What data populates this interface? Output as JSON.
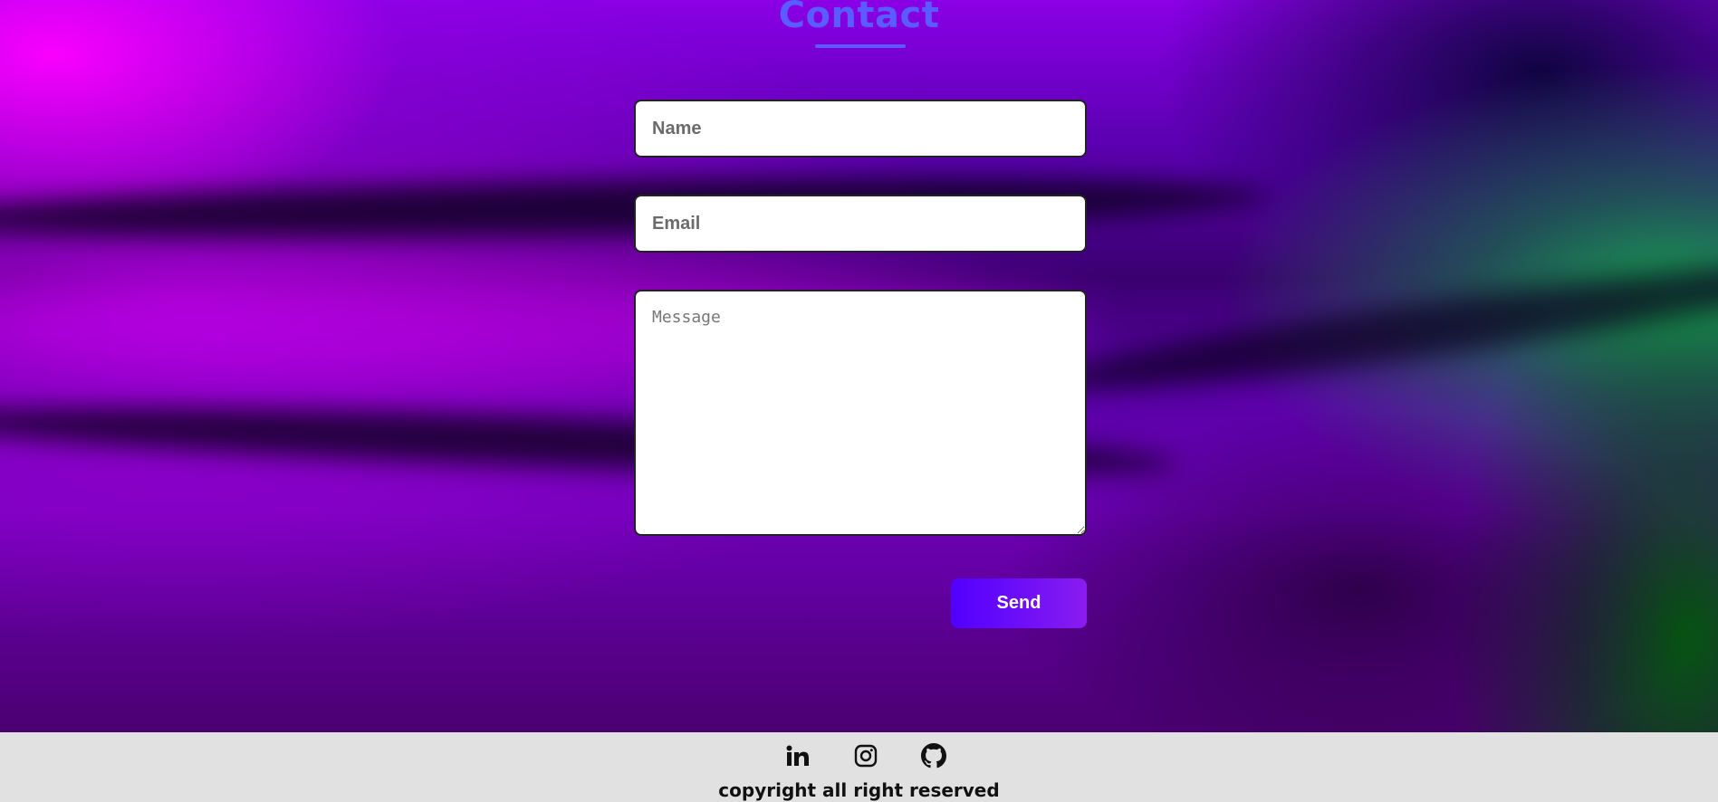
{
  "contact": {
    "title": "Contact",
    "title_color": "#5a5cff"
  },
  "form": {
    "name_placeholder": "Name",
    "email_placeholder": "Email",
    "message_placeholder": "Message",
    "send_label": "Send",
    "send_gradient": [
      "#5000ff",
      "#8a1cf0"
    ]
  },
  "footer": {
    "background": "#e1e1e1",
    "social_icons": [
      "linkedin-icon",
      "instagram-icon",
      "github-icon"
    ],
    "copyright": "copyright all right reserved"
  }
}
